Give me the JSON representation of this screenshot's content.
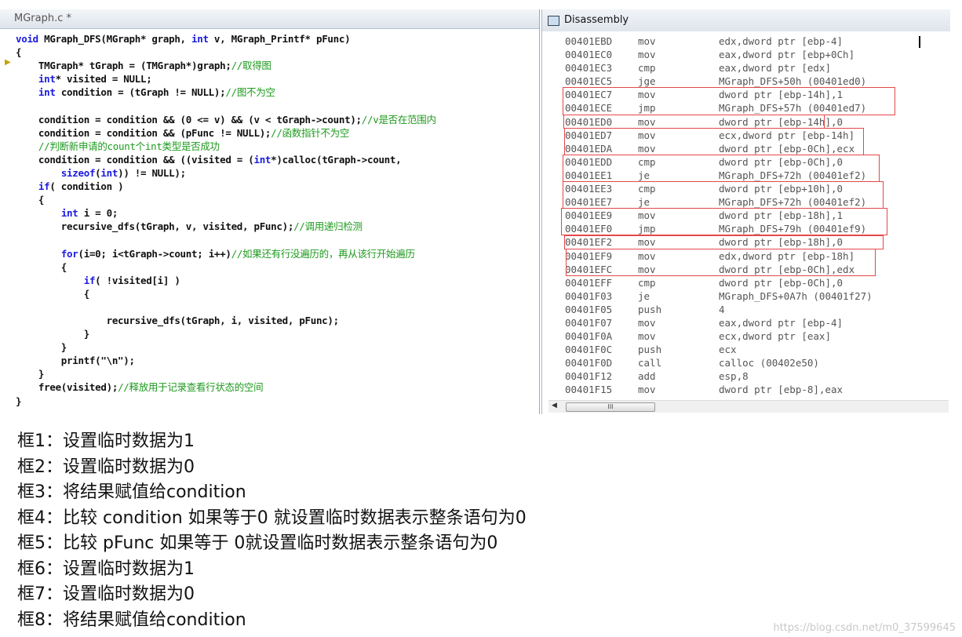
{
  "editor": {
    "tab_title": "MGraph.c *",
    "lines": [
      [
        [
          "kw",
          "void"
        ],
        [
          "p",
          " MGraph_DFS(MGraph* graph, "
        ],
        [
          "kw",
          "int"
        ],
        [
          "p",
          " v, MGraph_Printf* pFunc)"
        ]
      ],
      [
        [
          "p",
          "{"
        ]
      ],
      [
        [
          "p",
          "    TMGraph* tGraph = (TMGraph*)graph;"
        ],
        [
          "cm",
          "//取得图"
        ]
      ],
      [
        [
          "p",
          "    "
        ],
        [
          "kw",
          "int"
        ],
        [
          "p",
          "* visited = NULL;"
        ]
      ],
      [
        [
          "p",
          "    "
        ],
        [
          "kw",
          "int"
        ],
        [
          "p",
          " condition = (tGraph != NULL);"
        ],
        [
          "cm",
          "//图不为空"
        ]
      ],
      [
        [
          "p",
          ""
        ]
      ],
      [
        [
          "p",
          "    condition = condition && (0 <= v) && (v < tGraph->count);"
        ],
        [
          "cm",
          "//v是否在范围内"
        ]
      ],
      [
        [
          "p",
          "    condition = condition && (pFunc != NULL);"
        ],
        [
          "cm",
          "//函数指针不为空"
        ]
      ],
      [
        [
          "cm",
          "    //判断新申请的count个int类型是否成功"
        ]
      ],
      [
        [
          "p",
          "    condition = condition && ((visited = ("
        ],
        [
          "kw",
          "int"
        ],
        [
          "p",
          "*)calloc(tGraph->count,"
        ]
      ],
      [
        [
          "p",
          "        "
        ],
        [
          "kw",
          "sizeof"
        ],
        [
          "p",
          "("
        ],
        [
          "kw",
          "int"
        ],
        [
          "p",
          ")) != NULL);"
        ]
      ],
      [
        [
          "p",
          "    "
        ],
        [
          "kw",
          "if"
        ],
        [
          "p",
          "( condition )"
        ]
      ],
      [
        [
          "p",
          "    {"
        ]
      ],
      [
        [
          "p",
          "        "
        ],
        [
          "kw",
          "int"
        ],
        [
          "p",
          " i = 0;"
        ]
      ],
      [
        [
          "p",
          "        recursive_dfs(tGraph, v, visited, pFunc);"
        ],
        [
          "cm",
          "//调用递归检测"
        ]
      ],
      [
        [
          "p",
          ""
        ]
      ],
      [
        [
          "p",
          "        "
        ],
        [
          "kw",
          "for"
        ],
        [
          "p",
          "(i=0; i<tGraph->count; i++)"
        ],
        [
          "cm",
          "//如果还有行没遍历的，再从该行开始遍历"
        ]
      ],
      [
        [
          "p",
          "        {"
        ]
      ],
      [
        [
          "p",
          "            "
        ],
        [
          "kw",
          "if"
        ],
        [
          "p",
          "( !visited[i] )"
        ]
      ],
      [
        [
          "p",
          "            {"
        ]
      ],
      [
        [
          "p",
          ""
        ]
      ],
      [
        [
          "p",
          "                recursive_dfs(tGraph, i, visited, pFunc);"
        ]
      ],
      [
        [
          "p",
          "            }"
        ]
      ],
      [
        [
          "p",
          "        }"
        ]
      ],
      [
        [
          "p",
          "        printf(\"\\n\");"
        ]
      ],
      [
        [
          "p",
          "    }"
        ]
      ],
      [
        [
          "p",
          "    free(visited);"
        ],
        [
          "cm",
          "//释放用于记录查看行状态的空间"
        ]
      ],
      [
        [
          "p",
          "}"
        ]
      ]
    ]
  },
  "disassembly": {
    "title": "Disassembly",
    "rows": [
      [
        "00401EBD",
        "mov",
        "edx,dword ptr [ebp-4]"
      ],
      [
        "00401EC0",
        "mov",
        "eax,dword ptr [ebp+0Ch]"
      ],
      [
        "00401EC3",
        "cmp",
        "eax,dword ptr [edx]"
      ],
      [
        "00401EC5",
        "jge",
        "MGraph_DFS+50h (00401ed0)"
      ],
      [
        "00401EC7",
        "mov",
        "dword ptr [ebp-14h],1"
      ],
      [
        "00401ECE",
        "jmp",
        "MGraph_DFS+57h (00401ed7)"
      ],
      [
        "00401ED0",
        "mov",
        "dword ptr [ebp-14h],0"
      ],
      [
        "00401ED7",
        "mov",
        "ecx,dword ptr [ebp-14h]"
      ],
      [
        "00401EDA",
        "mov",
        "dword ptr [ebp-0Ch],ecx"
      ],
      [
        "00401EDD",
        "cmp",
        "dword ptr [ebp-0Ch],0"
      ],
      [
        "00401EE1",
        "je",
        "MGraph_DFS+72h (00401ef2)"
      ],
      [
        "00401EE3",
        "cmp",
        "dword ptr [ebp+10h],0"
      ],
      [
        "00401EE7",
        "je",
        "MGraph_DFS+72h (00401ef2)"
      ],
      [
        "00401EE9",
        "mov",
        "dword ptr [ebp-18h],1"
      ],
      [
        "00401EF0",
        "jmp",
        "MGraph_DFS+79h (00401ef9)"
      ],
      [
        "00401EF2",
        "mov",
        "dword ptr [ebp-18h],0"
      ],
      [
        "00401EF9",
        "mov",
        "edx,dword ptr [ebp-18h]"
      ],
      [
        "00401EFC",
        "mov",
        "dword ptr [ebp-0Ch],edx"
      ],
      [
        "00401EFF",
        "cmp",
        "dword ptr [ebp-0Ch],0"
      ],
      [
        "00401F03",
        "je",
        "MGraph_DFS+0A7h (00401f27)"
      ],
      [
        "00401F05",
        "push",
        "4"
      ],
      [
        "00401F07",
        "mov",
        "eax,dword ptr [ebp-4]"
      ],
      [
        "00401F0A",
        "mov",
        "ecx,dword ptr [eax]"
      ],
      [
        "00401F0C",
        "push",
        "ecx"
      ],
      [
        "00401F0D",
        "call",
        "calloc (00402e50)"
      ],
      [
        "00401F12",
        "add",
        "esp,8"
      ],
      [
        "00401F15",
        "mov",
        "dword ptr [ebp-8],eax"
      ]
    ],
    "highlight_boxes": [
      [
        4,
        5
      ],
      [
        6,
        6
      ],
      [
        7,
        8
      ],
      [
        9,
        10
      ],
      [
        11,
        12
      ],
      [
        13,
        14
      ],
      [
        15,
        15
      ],
      [
        16,
        17
      ]
    ],
    "box_color": "#e34848",
    "scroll_thumb": "III"
  },
  "notes": [
    "框1：设置临时数据为1",
    "框2：设置临时数据为0",
    "框3：将结果赋值给condition",
    "框4：比较 condition 如果等于0 就设置临时数据表示整条语句为0",
    "框5：比较 pFunc 如果等于 0就设置临时数据表示整条语句为0",
    "框6：设置临时数据为1",
    "框7：设置临时数据为0",
    "框8：将结果赋值给condition"
  ],
  "watermark": "https://blog.csdn.net/m0_37599645"
}
